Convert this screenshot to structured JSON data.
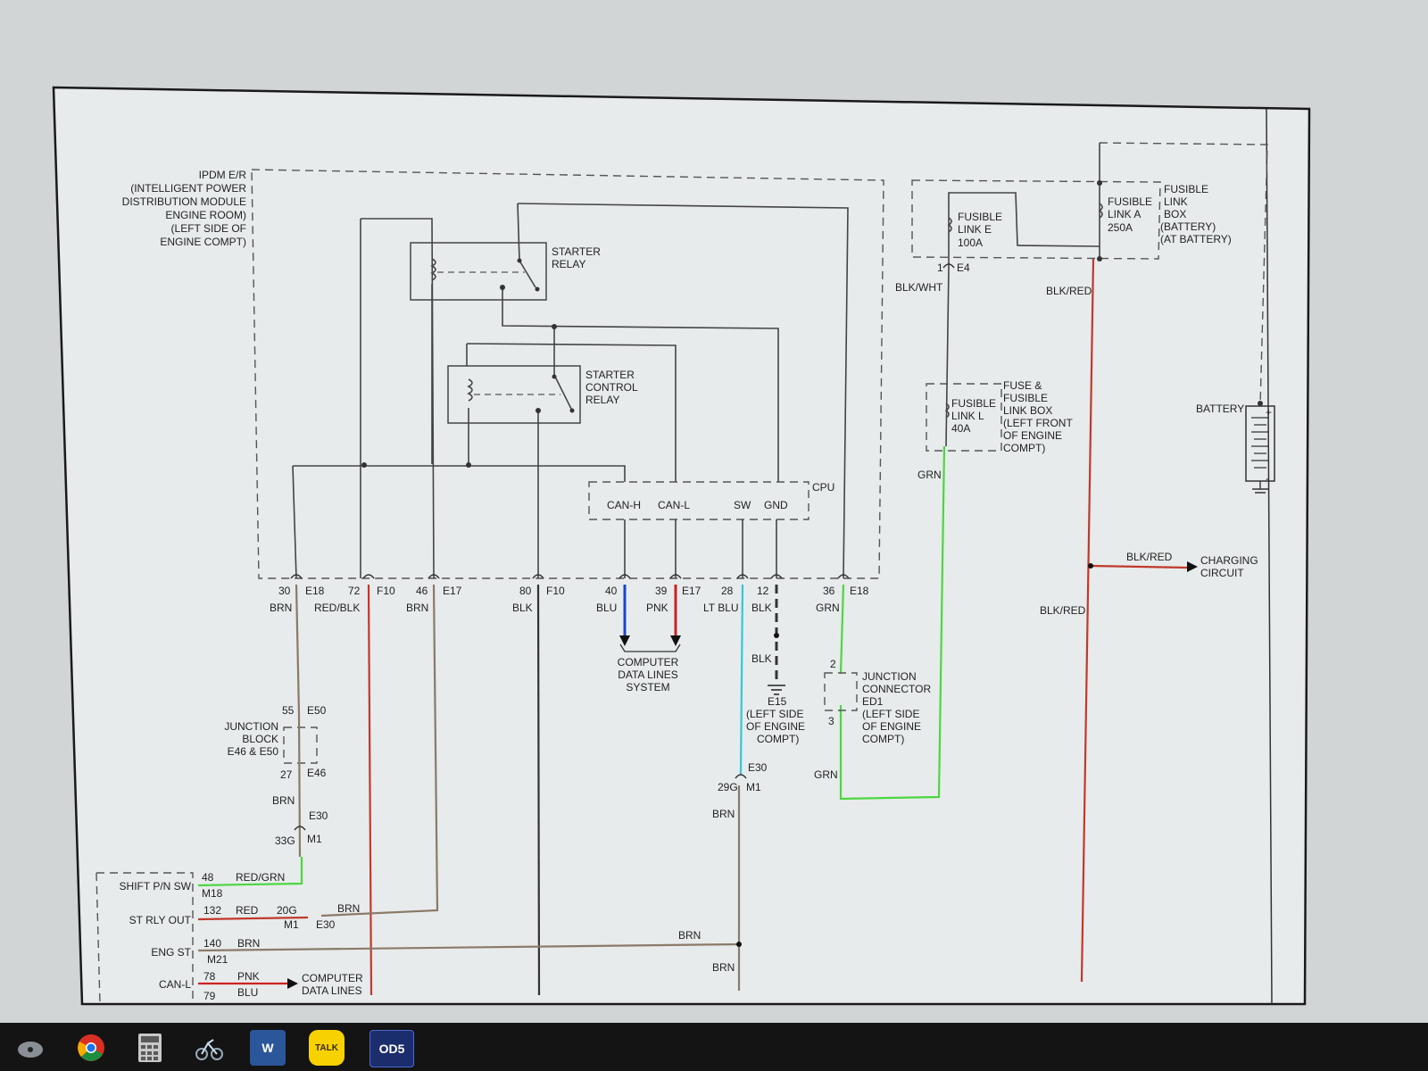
{
  "ipdm": {
    "lines": [
      "IPDM E/R",
      "(INTELLIGENT POWER",
      "DISTRIBUTION MODULE",
      "ENGINE ROOM)",
      "(LEFT SIDE OF",
      "ENGINE COMPT)"
    ]
  },
  "starter_relay": {
    "lines": [
      "STARTER",
      "RELAY"
    ]
  },
  "starter_control_relay": {
    "lines": [
      "STARTER",
      "CONTROL",
      "RELAY"
    ]
  },
  "cpu": {
    "label": "CPU",
    "pins": [
      "CAN-H",
      "CAN-L",
      "SW",
      "GND"
    ]
  },
  "fusible_link_e": {
    "lines": [
      "FUSIBLE",
      "LINK E",
      "100A"
    ]
  },
  "fusible_link_a": {
    "lines": [
      "FUSIBLE",
      "LINK A",
      "250A"
    ]
  },
  "fusible_link_box": {
    "lines": [
      "FUSIBLE",
      "LINK",
      "BOX",
      "(BATTERY)",
      "(AT BATTERY)"
    ]
  },
  "fusible_link_l": {
    "lines": [
      "FUSIBLE",
      "LINK L",
      "40A"
    ]
  },
  "fuse_box": {
    "lines": [
      "FUSE &",
      "FUSIBLE",
      "LINK BOX",
      "(LEFT FRONT",
      "OF ENGINE",
      "COMPT)"
    ]
  },
  "battery": {
    "label": "BATTERY",
    "plus": "+",
    "minus": "-"
  },
  "charging": {
    "wire": "BLK/RED",
    "lines": [
      "CHARGING",
      "CIRCUIT"
    ]
  },
  "connectors": {
    "e18": "E18",
    "f10": "F10",
    "e17": "E17",
    "e4": "E4",
    "e4_pin": "1"
  },
  "pins": [
    {
      "num": "30",
      "conn": "E18",
      "color": "BRN"
    },
    {
      "num": "72",
      "conn": "F10",
      "color": "RED/BLK"
    },
    {
      "num": "46",
      "conn": "E17",
      "color": "BRN"
    },
    {
      "num": "80",
      "conn": "F10",
      "color": "BLK"
    },
    {
      "num": "40",
      "conn": "",
      "color": "BLU"
    },
    {
      "num": "39",
      "conn": "E17",
      "color": "PNK"
    },
    {
      "num": "28",
      "conn": "",
      "color": "LT BLU"
    },
    {
      "num": "12",
      "conn": "",
      "color": "BLK"
    },
    {
      "num": "36",
      "conn": "E18",
      "color": "GRN"
    }
  ],
  "wires": {
    "blk_wht": "BLK/WHT",
    "blk_red": "BLK/RED",
    "blk_red_lower": "BLK/RED",
    "grn_l": "GRN",
    "grn_lower": "GRN",
    "blk_lower": "BLK",
    "red_grn": "RED/GRN",
    "red": "RED",
    "brn_stout": "BRN",
    "brn_engst": "BRN",
    "brn_junction": "BRN",
    "brn_mid": "BRN",
    "brn_lower": "BRN",
    "brn_bottom": "BRN",
    "pnk_bottom": "PNK",
    "blu_bottom": "BLU"
  },
  "computer_data_lines": {
    "lines": [
      "COMPUTER",
      "DATA LINES",
      "SYSTEM"
    ]
  },
  "computer_data_lines_bottom": {
    "lines": [
      "COMPUTER",
      "DATA LINES"
    ]
  },
  "ground_e15": {
    "lines": [
      "E15",
      "(LEFT SIDE",
      "OF ENGINE",
      "COMPT)"
    ]
  },
  "junction_connector": {
    "pin_top": "2",
    "pin_bottom": "3",
    "lines": [
      "JUNCTION",
      "CONNECTOR",
      "ED1",
      "(LEFT SIDE",
      "OF ENGINE",
      "COMPT)"
    ]
  },
  "junction_block": {
    "pin_top": "55",
    "conn_top": "E50",
    "pin_bottom": "27",
    "conn_bottom": "E46",
    "lines": [
      "JUNCTION",
      "BLOCK",
      "E46 & E50"
    ]
  },
  "conn_e30_m1_left": {
    "conn": "E30",
    "pin": "33G",
    "conn2": "M1"
  },
  "conn_e30_m1_mid": {
    "conn": "E30",
    "pin": "29G",
    "conn2": "M1"
  },
  "conn_e30_m1_stout": {
    "pin": "20G",
    "conn": "M1",
    "conn2": "E30"
  },
  "ecm": {
    "shift_label": "SHIFT P/N SW",
    "shift_pin": "48",
    "shift_conn": "M18",
    "strly_label": "ST RLY OUT",
    "strly_pin": "132",
    "engst_label": "ENG ST",
    "engst_pin": "140",
    "engst_conn": "M21",
    "canl_label": "CAN-L",
    "canl_pin": "78",
    "blu_pin": "79"
  },
  "colors": {
    "brn": "#8a7a6a",
    "red": "#c0392b",
    "blu": "#1a44cc",
    "pnk": "#cc2222",
    "ltblu": "#33c8d8",
    "grn": "#4cd640",
    "blk": "#333333"
  },
  "taskbar": {
    "apps": [
      {
        "icon": "disc-icon",
        "label": ""
      },
      {
        "icon": "chrome-icon",
        "label": ""
      },
      {
        "icon": "calculator-icon",
        "label": ""
      },
      {
        "icon": "rider-icon",
        "label": ""
      },
      {
        "icon": "word-icon",
        "label": "W"
      },
      {
        "icon": "talk-icon",
        "label": "TALK"
      },
      {
        "icon": "odis-icon",
        "label": "OD5"
      }
    ]
  }
}
